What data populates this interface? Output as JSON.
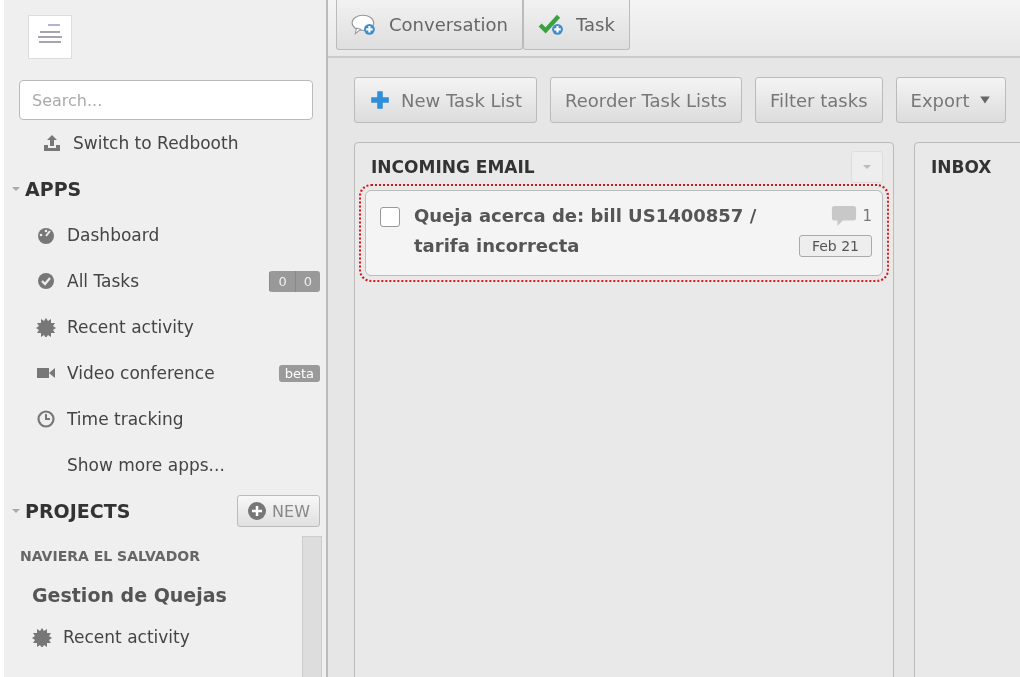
{
  "search": {
    "placeholder": "Search..."
  },
  "switch_link": {
    "label": "Switch to Redbooth"
  },
  "apps": {
    "title": "APPS",
    "expanded": true,
    "items": [
      {
        "kind": "dashboard",
        "label": "Dashboard"
      },
      {
        "kind": "tasks",
        "label": "All Tasks",
        "counts": [
          "0",
          "0"
        ]
      },
      {
        "kind": "activity",
        "label": "Recent activity"
      },
      {
        "kind": "video",
        "label": "Video conference",
        "badge": "beta"
      },
      {
        "kind": "clock",
        "label": "Time tracking"
      },
      {
        "kind": "more",
        "label": "Show more apps..."
      }
    ]
  },
  "projects": {
    "title": "PROJECTS",
    "expanded": true,
    "new_button": "NEW",
    "organization": "NAVIERA EL SALVADOR",
    "project": "Gestion de Quejas",
    "items": [
      {
        "kind": "activity",
        "label": "Recent activity"
      }
    ]
  },
  "top_tabs": [
    {
      "kind": "conversation",
      "label": "Conversation"
    },
    {
      "kind": "task",
      "label": "Task"
    }
  ],
  "toolbar": [
    {
      "kind": "add",
      "label": "New Task List"
    },
    {
      "kind": "plain",
      "label": "Reorder Task Lists"
    },
    {
      "kind": "plain",
      "label": "Filter tasks"
    },
    {
      "kind": "dropdown",
      "label": "Export"
    }
  ],
  "task_lists": [
    {
      "title": "INCOMING EMAIL",
      "tasks": [
        {
          "title": "Queja acerca de: bill US1400857 / tarifa incorrecta",
          "checked": false,
          "selected": true,
          "comments": "1",
          "date": "Feb 21"
        }
      ]
    },
    {
      "title": "INBOX"
    }
  ]
}
